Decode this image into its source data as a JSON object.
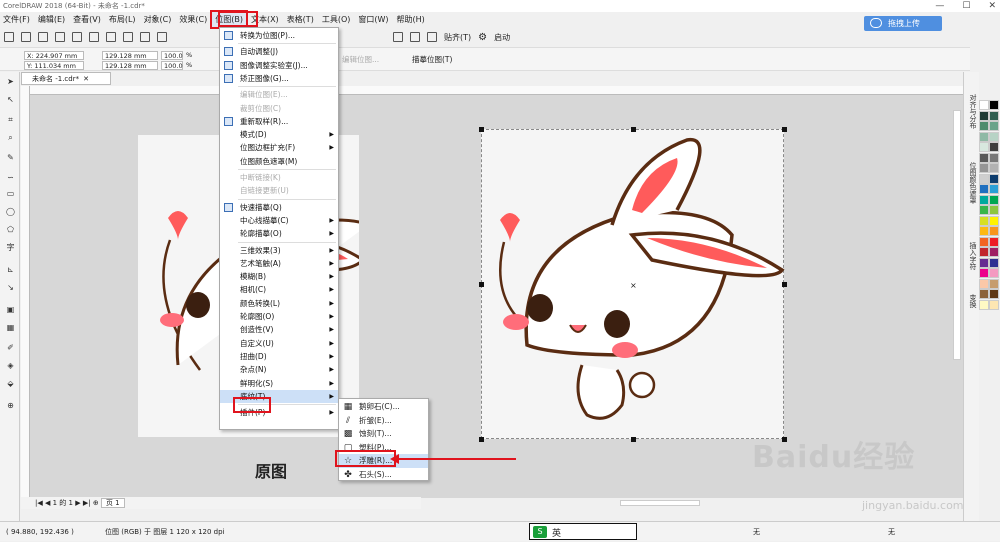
{
  "window": {
    "title": "CorelDRAW 2018 (64-Bit) - 未命名 -1.cdr*"
  },
  "menubar": {
    "items": [
      "文件(F)",
      "编辑(E)",
      "查看(V)",
      "布局(L)",
      "对象(C)",
      "效果(C)",
      "位图(B)",
      "文本(X)",
      "表格(T)",
      "工具(O)",
      "窗口(W)",
      "帮助(H)"
    ]
  },
  "upload_button": "拖拽上传",
  "toolbar1": {
    "snap_label": "贴齐(T)",
    "launch_label": "启动"
  },
  "propbar": {
    "x": "X: 224.907 mm",
    "y": "Y: 111.034 mm",
    "w": "129.128 mm",
    "h": "129.128 mm",
    "sx": "100.0",
    "sy": "100.0",
    "pct": "%",
    "editbitmap": "编辑位图...",
    "trace": "描摹位图(T)"
  },
  "doc_tab": "未命名 -1.cdr*",
  "bitmap_menu": {
    "items": [
      {
        "label": "转换为位图(P)...",
        "disabled": false,
        "submenu": false
      },
      {
        "sep": true
      },
      {
        "label": "自动调整(J)",
        "disabled": false,
        "submenu": false
      },
      {
        "label": "图像调整实验室(J)...",
        "disabled": false,
        "submenu": false
      },
      {
        "label": "矫正图像(G)...",
        "disabled": false,
        "submenu": false
      },
      {
        "sep": true
      },
      {
        "label": "编辑位图(E)...",
        "disabled": true,
        "submenu": false
      },
      {
        "label": "裁剪位图(C)",
        "disabled": true,
        "submenu": false
      },
      {
        "label": "重新取样(R)...",
        "disabled": false,
        "submenu": false
      },
      {
        "label": "模式(D)",
        "disabled": false,
        "submenu": true
      },
      {
        "label": "位图边框扩充(F)",
        "disabled": false,
        "submenu": true
      },
      {
        "label": "位图颜色遮罩(M)",
        "disabled": false,
        "submenu": false
      },
      {
        "sep": true
      },
      {
        "label": "中断链接(K)",
        "disabled": true,
        "submenu": false
      },
      {
        "label": "自链接更新(U)",
        "disabled": true,
        "submenu": false
      },
      {
        "sep": true
      },
      {
        "label": "快速描摹(Q)",
        "disabled": false,
        "submenu": false
      },
      {
        "label": "中心线描摹(C)",
        "disabled": false,
        "submenu": true
      },
      {
        "label": "轮廓描摹(O)",
        "disabled": false,
        "submenu": true
      },
      {
        "sep": true
      },
      {
        "label": "三维效果(3)",
        "disabled": false,
        "submenu": true
      },
      {
        "label": "艺术笔触(A)",
        "disabled": false,
        "submenu": true
      },
      {
        "label": "模糊(B)",
        "disabled": false,
        "submenu": true
      },
      {
        "label": "相机(C)",
        "disabled": false,
        "submenu": true
      },
      {
        "label": "颜色转换(L)",
        "disabled": false,
        "submenu": true
      },
      {
        "label": "轮廓图(O)",
        "disabled": false,
        "submenu": true
      },
      {
        "label": "创造性(V)",
        "disabled": false,
        "submenu": true
      },
      {
        "label": "自定义(U)",
        "disabled": false,
        "submenu": true
      },
      {
        "label": "扭曲(D)",
        "disabled": false,
        "submenu": true
      },
      {
        "label": "杂点(N)",
        "disabled": false,
        "submenu": true
      },
      {
        "label": "鲜明化(S)",
        "disabled": false,
        "submenu": true
      },
      {
        "label": "底纹(T)",
        "disabled": false,
        "submenu": true,
        "active": true
      },
      {
        "sep": true
      },
      {
        "label": "插件(P)",
        "disabled": false,
        "submenu": true
      }
    ]
  },
  "texture_submenu": {
    "items": [
      "鹅卵石(C)...",
      "折皱(E)...",
      "蚀刻(T)...",
      "塑料(P)...",
      "浮雕(R)...",
      "石头(S)..."
    ]
  },
  "canvas": {
    "caption": "原图"
  },
  "pagebar": {
    "page_of": "1 的 1",
    "page_tab": "页 1"
  },
  "dockers": {
    "tabs": [
      "对齐与分布",
      "位图颜色遮罩",
      "插入字符",
      "变换"
    ]
  },
  "status": {
    "coords": "( 94.880, 192.436 )",
    "info": "位图 (RGB) 于 图层 1 120 x 120 dpi",
    "fill": "无",
    "outline": "无"
  },
  "ime": {
    "lang": "英"
  },
  "watermark": {
    "brand": "Baidu经验",
    "url": "jingyan.baidu.com"
  },
  "colors": {
    "accent": "#e0141e",
    "menuhl": "#cde0f7",
    "upload": "#4f8fe0"
  },
  "palette": [
    "#ffffff",
    "#000000",
    "#1e3a34",
    "#2e5d4f",
    "#4e8c6d",
    "#6aa38a",
    "#8fb9a5",
    "#b7d3c5",
    "#d8e8df",
    "#3e3e3e",
    "#595959",
    "#777",
    "#959595",
    "#b2b2b2",
    "#cfcfcf",
    "#0d3d6e",
    "#1f6fbf",
    "#2a9fd6",
    "#00a99d",
    "#00a651",
    "#39b54a",
    "#8dc63f",
    "#d7df23",
    "#fff200",
    "#fdb913",
    "#f7941d",
    "#f26522",
    "#ed1c24",
    "#c1272d",
    "#9e1f63",
    "#662d91",
    "#2e3192",
    "#ec008c",
    "#f49ac1",
    "#fbc8a8",
    "#c69c6d",
    "#8c6239",
    "#603813",
    "#fff9c4",
    "#fde6b2"
  ]
}
